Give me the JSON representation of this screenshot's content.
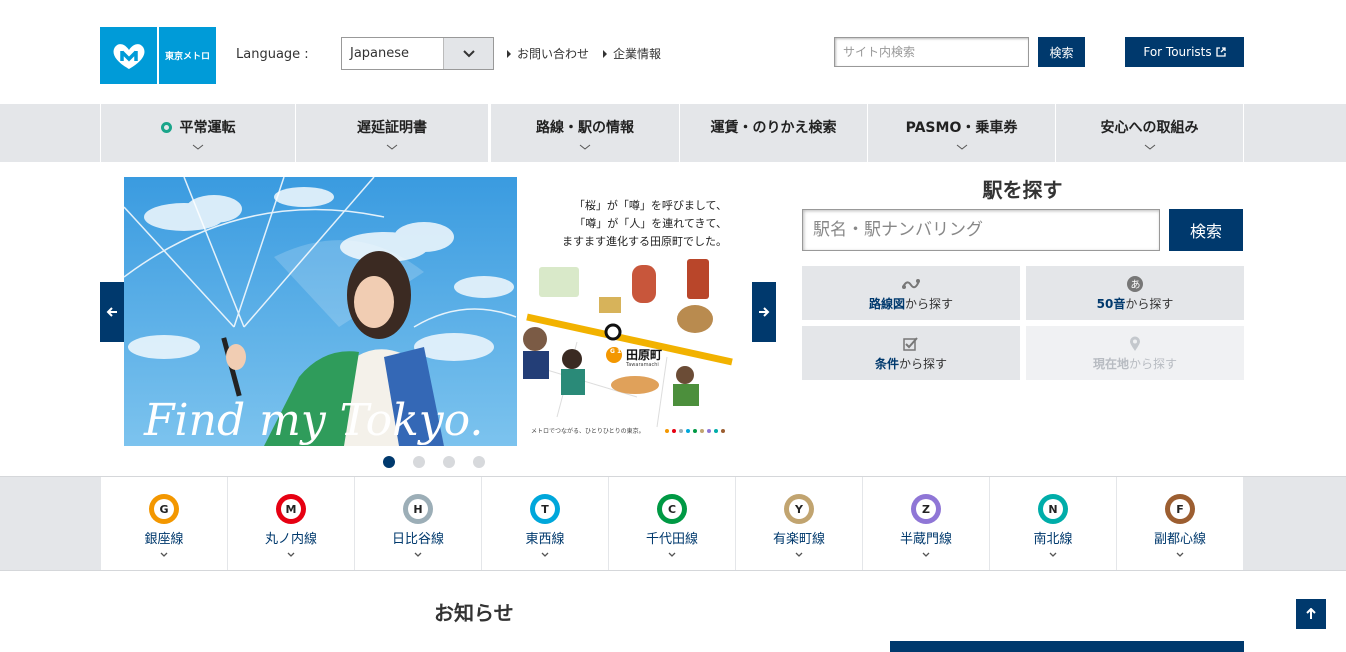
{
  "header": {
    "logo_text": "東京メトロ",
    "language_label": "Language :",
    "language_value": "Japanese",
    "links": [
      "お問い合わせ",
      "企業情報"
    ],
    "search_placeholder": "サイト内検索",
    "search_button": "検索",
    "tourists_button": "For Tourists"
  },
  "nav": {
    "items": [
      {
        "label": "平常運転",
        "status_icon": "green-circle"
      },
      {
        "label": "遅延証明書"
      },
      {
        "label": "路線・駅の情報"
      },
      {
        "label": "運賃・のりかえ検索"
      },
      {
        "label": "PASMO・乗車券"
      },
      {
        "label": "安心への取組み"
      }
    ]
  },
  "hero": {
    "tagline": "Find my Tokyo.",
    "copy_lines": [
      "「桜」が「噂」を呼びまして、",
      "「噂」が「人」を連れてきて、",
      "ますます進化する田原町でした。"
    ],
    "station_code": "G 18",
    "station_name": "田原町",
    "station_roman": "Tawaramachi",
    "footer_text": "メトロでつながる、ひとりひとりの東京。",
    "slides_total": 4,
    "active_slide": 1
  },
  "finder": {
    "title": "駅を探す",
    "input_placeholder": "駅名・駅ナンバリング",
    "search_button": "検索",
    "buttons": [
      {
        "bold": "路線図",
        "rest": "から探す",
        "icon": "route-map-icon",
        "enabled": true
      },
      {
        "bold": "50音",
        "rest": "から探す",
        "icon": "kana-icon",
        "enabled": true
      },
      {
        "bold": "条件",
        "rest": "から探す",
        "icon": "checkbox-icon",
        "enabled": true
      },
      {
        "bold": "現在地",
        "rest": "から探す",
        "icon": "location-pin-icon",
        "enabled": false
      }
    ]
  },
  "lines": [
    {
      "letter": "G",
      "name": "銀座線",
      "color": "#f39700"
    },
    {
      "letter": "M",
      "name": "丸ノ内線",
      "color": "#e60012"
    },
    {
      "letter": "H",
      "name": "日比谷線",
      "color": "#9caeb7"
    },
    {
      "letter": "T",
      "name": "東西線",
      "color": "#00a7db"
    },
    {
      "letter": "C",
      "name": "千代田線",
      "color": "#009944"
    },
    {
      "letter": "Y",
      "name": "有楽町線",
      "color": "#c1a470"
    },
    {
      "letter": "Z",
      "name": "半蔵門線",
      "color": "#8f76d6"
    },
    {
      "letter": "N",
      "name": "南北線",
      "color": "#00ada9"
    },
    {
      "letter": "F",
      "name": "副都心線",
      "color": "#9c5e31"
    }
  ],
  "news": {
    "title": "お知らせ"
  },
  "colors": {
    "brand": "#00396d",
    "logo": "#009bd8",
    "nav_bg": "#e4e6e9"
  }
}
